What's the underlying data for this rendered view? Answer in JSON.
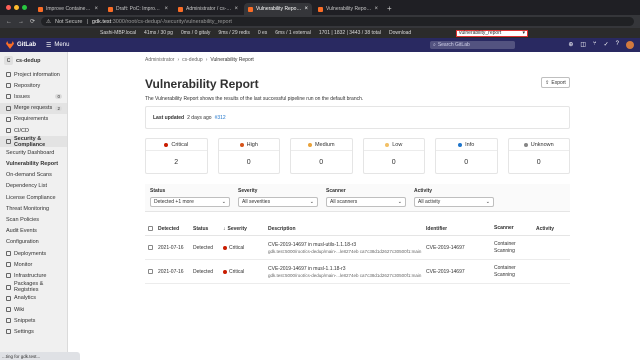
{
  "browser": {
    "tabs": [
      {
        "title": "Improve Container Scanning w"
      },
      {
        "title": "Draft: PoC: Improve containe"
      },
      {
        "title": "Administrator / cs-dedup-mu"
      },
      {
        "title": "Vulnerability Report - Admini"
      },
      {
        "title": "Vulnerability Report - Sashi H"
      }
    ],
    "active_tab_index": 3,
    "new_tab": "+",
    "nav_back": "←",
    "nav_forward": "→",
    "reload": "⟳",
    "not_secure": "Not Secure",
    "url_host": "gdk.test",
    "url_path": ":3000/root/cs-dedup/-/security/vulnerability_report"
  },
  "perfbar": {
    "host": "Sashi-MBP.local",
    "pg": "41ms / 30 pg",
    "gitaly": "0ms / 0 gitaly",
    "redis": "9ms / 29 redis",
    "es": "0 es",
    "external": "6ms / 1 external",
    "memory": "1701 | 1832 | 3443 / 38 total",
    "download": "Download",
    "selected": "vulnerability_report"
  },
  "header": {
    "brand": "GitLab",
    "menu_label": "Menu",
    "search_placeholder": "Search GitLab"
  },
  "sidebar": {
    "project_initial": "C",
    "project_name": "cs-dedup",
    "items": [
      {
        "label": "Project information"
      },
      {
        "label": "Repository"
      },
      {
        "label": "Issues",
        "badge": "0"
      },
      {
        "label": "Merge requests",
        "badge": "2"
      },
      {
        "label": "Requirements"
      },
      {
        "label": "CI/CD"
      },
      {
        "label": "Security & Compliance"
      }
    ],
    "sub_items": [
      {
        "label": "Security Dashboard"
      },
      {
        "label": "Vulnerability Report"
      },
      {
        "label": "On-demand Scans"
      },
      {
        "label": "Dependency List"
      },
      {
        "label": "License Compliance"
      },
      {
        "label": "Threat Monitoring"
      },
      {
        "label": "Scan Policies"
      },
      {
        "label": "Audit Events"
      },
      {
        "label": "Configuration"
      }
    ],
    "items_after": [
      {
        "label": "Deployments"
      },
      {
        "label": "Monitor"
      },
      {
        "label": "Infrastructure"
      },
      {
        "label": "Packages & Registries"
      },
      {
        "label": "Analytics"
      },
      {
        "label": "Wiki"
      },
      {
        "label": "Snippets"
      },
      {
        "label": "Settings"
      }
    ],
    "status_text": "...ting for gdk.test..."
  },
  "breadcrumb": [
    "Administrator",
    "cs-dedup",
    "Vulnerability Report"
  ],
  "breadcrumb_separator": "›",
  "page": {
    "title": "Vulnerability Report",
    "export_label": "Export",
    "description": "The Vulnerability Report shows the results of the last successful pipeline run on the default branch.",
    "last_updated_label": "Last updated",
    "last_updated_value": "2 days ago",
    "pipeline_link": "#312"
  },
  "severities": [
    {
      "label": "Critical",
      "count": "2",
      "color": "#c91c00"
    },
    {
      "label": "High",
      "count": "0",
      "color": "#d6541a"
    },
    {
      "label": "Medium",
      "count": "0",
      "color": "#e9a23b"
    },
    {
      "label": "Low",
      "count": "0",
      "color": "#f2c066"
    },
    {
      "label": "Info",
      "count": "0",
      "color": "#1f75cb"
    },
    {
      "label": "Unknown",
      "count": "0",
      "color": "#868686"
    }
  ],
  "filters": [
    {
      "label": "Status",
      "value": "Detected +1 more"
    },
    {
      "label": "Severity",
      "value": "All severities"
    },
    {
      "label": "Scanner",
      "value": "All scanners"
    },
    {
      "label": "Activity",
      "value": "All activity"
    }
  ],
  "table": {
    "headers": {
      "detected": "Detected",
      "status": "Status",
      "severity": "Severity",
      "description": "Description",
      "identifier": "Identifier",
      "scanner": "Scanner",
      "activity": "Activity"
    },
    "rows": [
      {
        "detected": "2021-07-16",
        "status": "Detected",
        "severity": "Critical",
        "description": "CVE-2019-14697 in musl-utils-1.1.18-r3",
        "path": "gdk.test:5000/root/cs-dedup/main-...le8274eb ca7c38d1d2627c30500f1:main",
        "identifier": "CVE-2019-14697",
        "scanner": "Container Scanning"
      },
      {
        "detected": "2021-07-16",
        "status": "Detected",
        "severity": "Critical",
        "description": "CVE-2019-14697 in musl-1.1.18-r3",
        "path": "gdk.test:5000/root/cs-dedup/main-...le8274eb ca7c38d1d2627c30500f1:main",
        "identifier": "CVE-2019-14697",
        "scanner": "Container Scanning"
      }
    ]
  }
}
